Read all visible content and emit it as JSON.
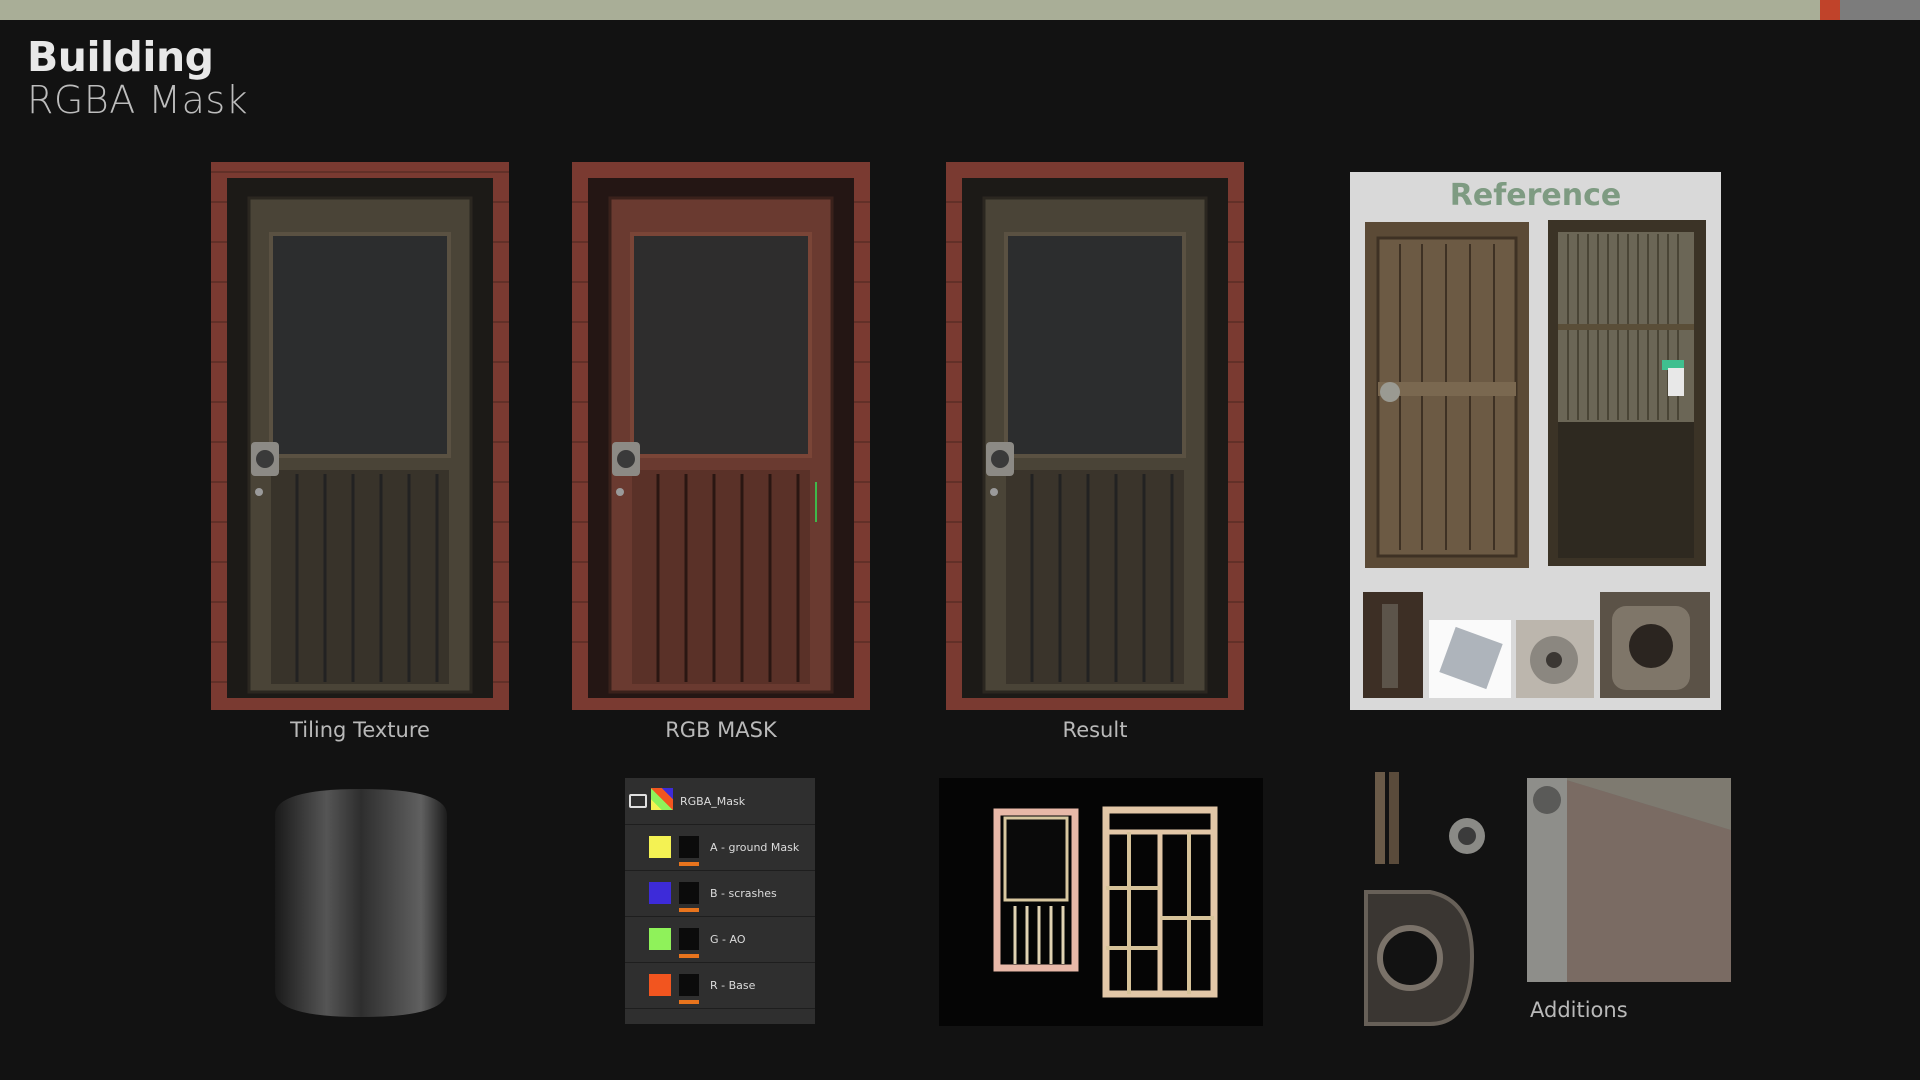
{
  "header": {
    "title": "Building",
    "subtitle": "RGBA Mask"
  },
  "panels": [
    {
      "caption": "Tiling Texture"
    },
    {
      "caption": "RGB MASK"
    },
    {
      "caption": "Result"
    }
  ],
  "reference": {
    "title": "Reference"
  },
  "layers": {
    "group_label": "RGBA_Mask",
    "items": [
      {
        "label": "A - ground Mask",
        "color": "#f4f253"
      },
      {
        "label": "B - scrashes",
        "color": "#3d2bd9"
      },
      {
        "label": "G - AO",
        "color": "#8ff25a"
      },
      {
        "label": "R - Base",
        "color": "#f2551f"
      }
    ]
  },
  "additions": {
    "caption": "Additions"
  },
  "colors": {
    "topbar": "#a9ae97",
    "accent_red": "#c0432a",
    "reference_title": "#7e9b82",
    "layer_bar": "#e8741d"
  }
}
